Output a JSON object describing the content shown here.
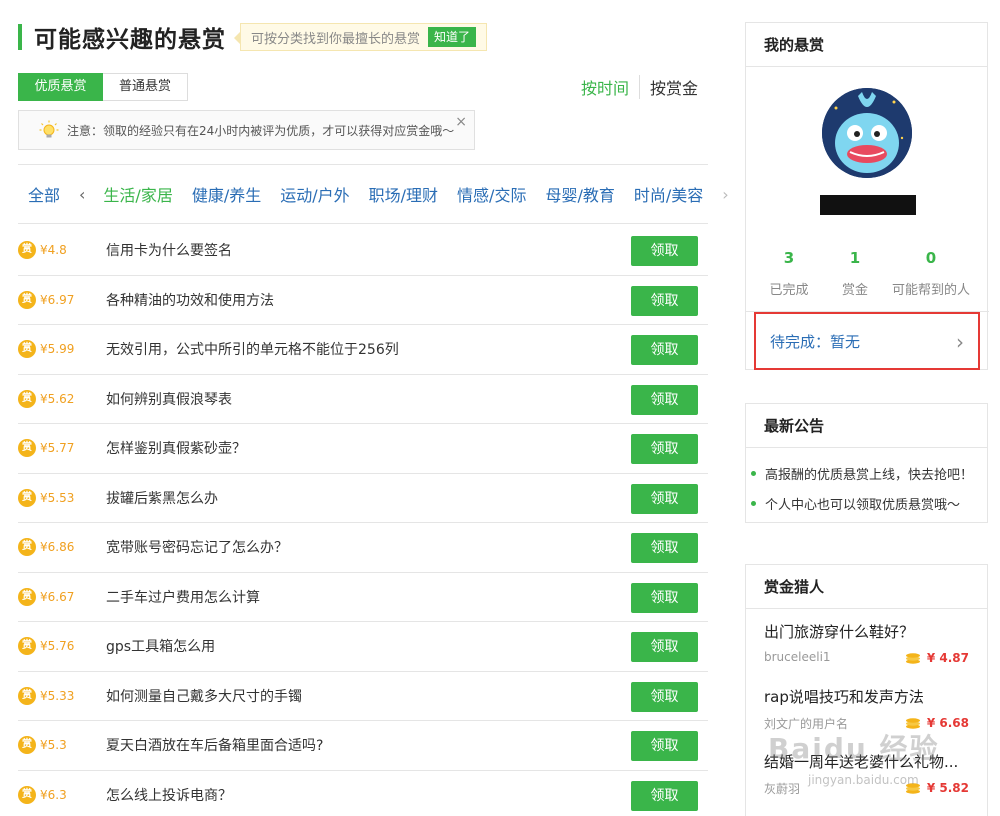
{
  "header": {
    "title": "可能感兴趣的悬赏",
    "tip_text": "可按分类找到你最擅长的悬赏",
    "tip_button": "知道了"
  },
  "tabs": [
    {
      "label": "优质悬赏",
      "active": true
    },
    {
      "label": "普通悬赏",
      "active": false
    }
  ],
  "sort": {
    "by_time": "按时间",
    "by_money": "按赏金"
  },
  "notice": {
    "text": "注意：领取的经验只有在24小时内被评为优质，才可以获得对应赏金哦～",
    "close": "×"
  },
  "categories": {
    "all": "全部",
    "items": [
      "生活/家居",
      "健康/养生",
      "运动/户外",
      "职场/理财",
      "情感/交际",
      "母婴/教育",
      "时尚/美容"
    ],
    "active_index": 0
  },
  "coin_label": "赏",
  "claim_label": "领取",
  "bounties": [
    {
      "price": "¥4.8",
      "question": "信用卡为什么要签名"
    },
    {
      "price": "¥6.97",
      "question": "各种精油的功效和使用方法"
    },
    {
      "price": "¥5.99",
      "question": "无效引用，公式中所引的单元格不能位于256列"
    },
    {
      "price": "¥5.62",
      "question": "如何辨别真假浪琴表"
    },
    {
      "price": "¥5.77",
      "question": "怎样鉴别真假紫砂壶？"
    },
    {
      "price": "¥5.53",
      "question": "拔罐后紫黑怎么办"
    },
    {
      "price": "¥6.86",
      "question": "宽带账号密码忘记了怎么办？"
    },
    {
      "price": "¥6.67",
      "question": "二手车过户费用怎么计算"
    },
    {
      "price": "¥5.76",
      "question": "gps工具箱怎么用"
    },
    {
      "price": "¥5.33",
      "question": "如何测量自己戴多大尺寸的手镯"
    },
    {
      "price": "¥5.3",
      "question": "夏天白酒放在车后备箱里面合适吗?"
    },
    {
      "price": "¥6.3",
      "question": "怎么线上投诉电商？"
    }
  ],
  "my_bounty": {
    "title": "我的悬赏",
    "stats": [
      {
        "value": "3",
        "label": "已完成"
      },
      {
        "value": "1",
        "label": "赏金"
      },
      {
        "value": "0",
        "label": "可能帮到的人"
      }
    ],
    "pending": "待完成：暂无"
  },
  "announcements": {
    "title": "最新公告",
    "items": [
      "高报酬的优质悬赏上线，快去抢吧！",
      "个人中心也可以领取优质悬赏哦～"
    ]
  },
  "hunters": {
    "title": "赏金猎人",
    "items": [
      {
        "question": "出门旅游穿什么鞋好？",
        "user": "bruceleeli1",
        "money": "¥ 4.87"
      },
      {
        "question": "rap说唱技巧和发声方法",
        "user": "刘文广的用户名",
        "money": "¥ 6.68"
      },
      {
        "question": "结婚一周年送老婆什么礼物...",
        "user": "灰蔚羽",
        "money": "¥ 5.82"
      }
    ]
  },
  "watermark": {
    "text": "Baidu 经验",
    "url": "jingyan.baidu.com"
  },
  "colors": {
    "accent": "#3ab54a",
    "link": "#2a6db5",
    "money": "#f0a020",
    "highlight": "#e53935"
  }
}
